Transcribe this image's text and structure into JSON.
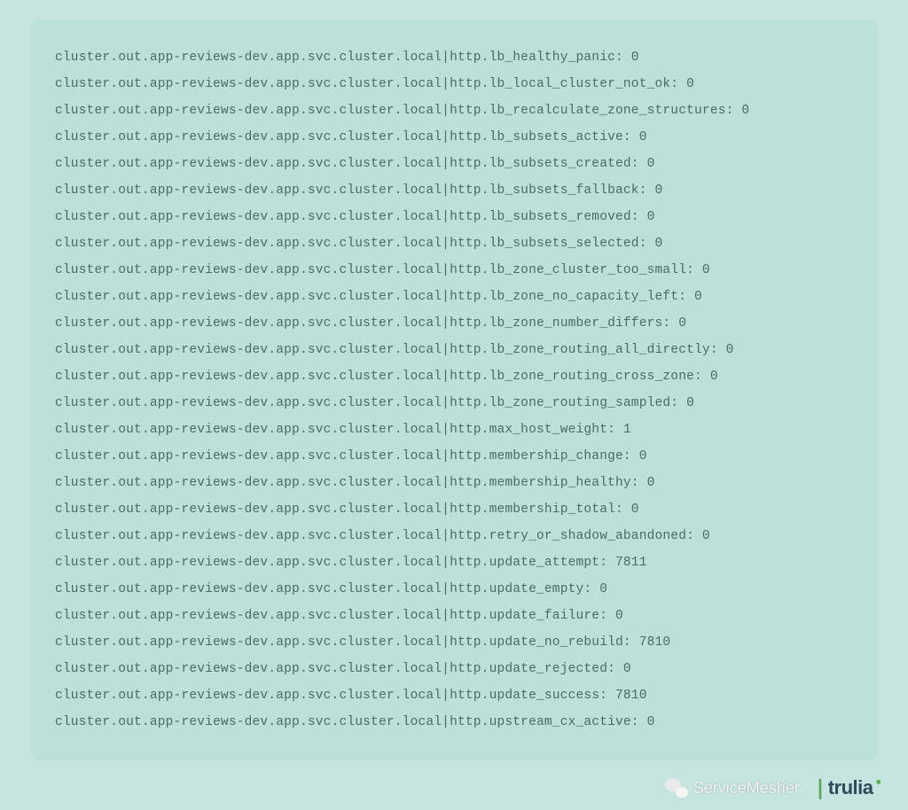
{
  "prefix": "cluster.out.app-reviews-dev.app.svc.cluster.local|http.",
  "metrics": [
    {
      "key": "lb_healthy_panic",
      "value": "0"
    },
    {
      "key": "lb_local_cluster_not_ok",
      "value": "0"
    },
    {
      "key": "lb_recalculate_zone_structures",
      "value": "0"
    },
    {
      "key": "lb_subsets_active",
      "value": "0"
    },
    {
      "key": "lb_subsets_created",
      "value": "0"
    },
    {
      "key": "lb_subsets_fallback",
      "value": "0"
    },
    {
      "key": "lb_subsets_removed",
      "value": "0"
    },
    {
      "key": "lb_subsets_selected",
      "value": "0"
    },
    {
      "key": "lb_zone_cluster_too_small",
      "value": "0"
    },
    {
      "key": "lb_zone_no_capacity_left",
      "value": "0"
    },
    {
      "key": "lb_zone_number_differs",
      "value": "0"
    },
    {
      "key": "lb_zone_routing_all_directly",
      "value": "0"
    },
    {
      "key": "lb_zone_routing_cross_zone",
      "value": "0"
    },
    {
      "key": "lb_zone_routing_sampled",
      "value": "0"
    },
    {
      "key": "max_host_weight",
      "value": "1"
    },
    {
      "key": "membership_change",
      "value": "0"
    },
    {
      "key": "membership_healthy",
      "value": "0"
    },
    {
      "key": "membership_total",
      "value": "0"
    },
    {
      "key": "retry_or_shadow_abandoned",
      "value": "0"
    },
    {
      "key": "update_attempt",
      "value": "7811"
    },
    {
      "key": "update_empty",
      "value": "0"
    },
    {
      "key": "update_failure",
      "value": "0"
    },
    {
      "key": "update_no_rebuild",
      "value": "7810"
    },
    {
      "key": "update_rejected",
      "value": "0"
    },
    {
      "key": "update_success",
      "value": "7810"
    },
    {
      "key": "upstream_cx_active",
      "value": "0"
    }
  ],
  "footer": {
    "service_mesher": "ServiceMesher",
    "brand": "trulia"
  }
}
